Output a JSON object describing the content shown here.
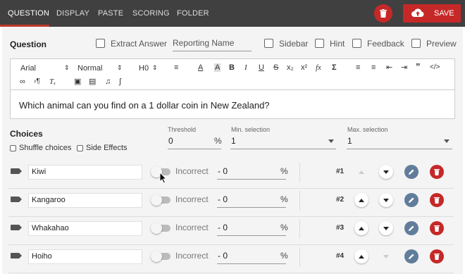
{
  "tabs": [
    {
      "label": "QUESTION",
      "active": true
    },
    {
      "label": "DISPLAY"
    },
    {
      "label": "PASTE"
    },
    {
      "label": "SCORING"
    },
    {
      "label": "FOLDER"
    }
  ],
  "actions": {
    "save_label": "SAVE"
  },
  "question": {
    "title": "Question",
    "extract_answer": "Extract Answer",
    "reporting_name_placeholder": "Reporting Name",
    "options": [
      "Sidebar",
      "Hint",
      "Feedback",
      "Preview"
    ]
  },
  "toolbar": {
    "font": "Arial",
    "size": "Normal",
    "heading": "H0",
    "icons": [
      "align-icon",
      "text-color-icon",
      "background-color-icon",
      "bold-icon",
      "italic-icon",
      "underline-icon",
      "strike-icon",
      "subscript-icon",
      "superscript-icon",
      "formula-icon",
      "sigma-icon",
      "ordered-list-icon",
      "bullet-list-icon",
      "outdent-icon",
      "indent-icon",
      "blockquote-icon",
      "code-icon",
      "link-icon",
      "paragraph-direction-icon",
      "clear-format-icon",
      "image-icon",
      "video-icon",
      "audio-icon",
      "attachment-icon"
    ]
  },
  "editor": {
    "text": "Which animal can you find on a 1 dollar coin in New Zealand?"
  },
  "choices": {
    "title": "Choices",
    "shuffle_label": "Shuffle choices",
    "side_effects_label": "Side Effects",
    "threshold": {
      "label": "Threshold",
      "value": "0",
      "unit": "%"
    },
    "min_selection": {
      "label": "Min. selection",
      "value": "1"
    },
    "max_selection": {
      "label": "Max. selection",
      "value": "1"
    },
    "items": [
      {
        "text": "Kiwi",
        "status": "Incorrect",
        "score": "- 0",
        "unit": "%",
        "number": "#1"
      },
      {
        "text": "Kangaroo",
        "status": "Incorrect",
        "score": "- 0",
        "unit": "%",
        "number": "#2"
      },
      {
        "text": "Whakahao",
        "status": "Incorrect",
        "score": "- 0",
        "unit": "%",
        "number": "#3"
      },
      {
        "text": "Hoiho",
        "status": "Incorrect",
        "score": "- 0",
        "unit": "%",
        "number": "#4"
      }
    ]
  },
  "colors": {
    "topbar": "#404040",
    "danger": "#c62828",
    "edit": "#607d9b"
  }
}
